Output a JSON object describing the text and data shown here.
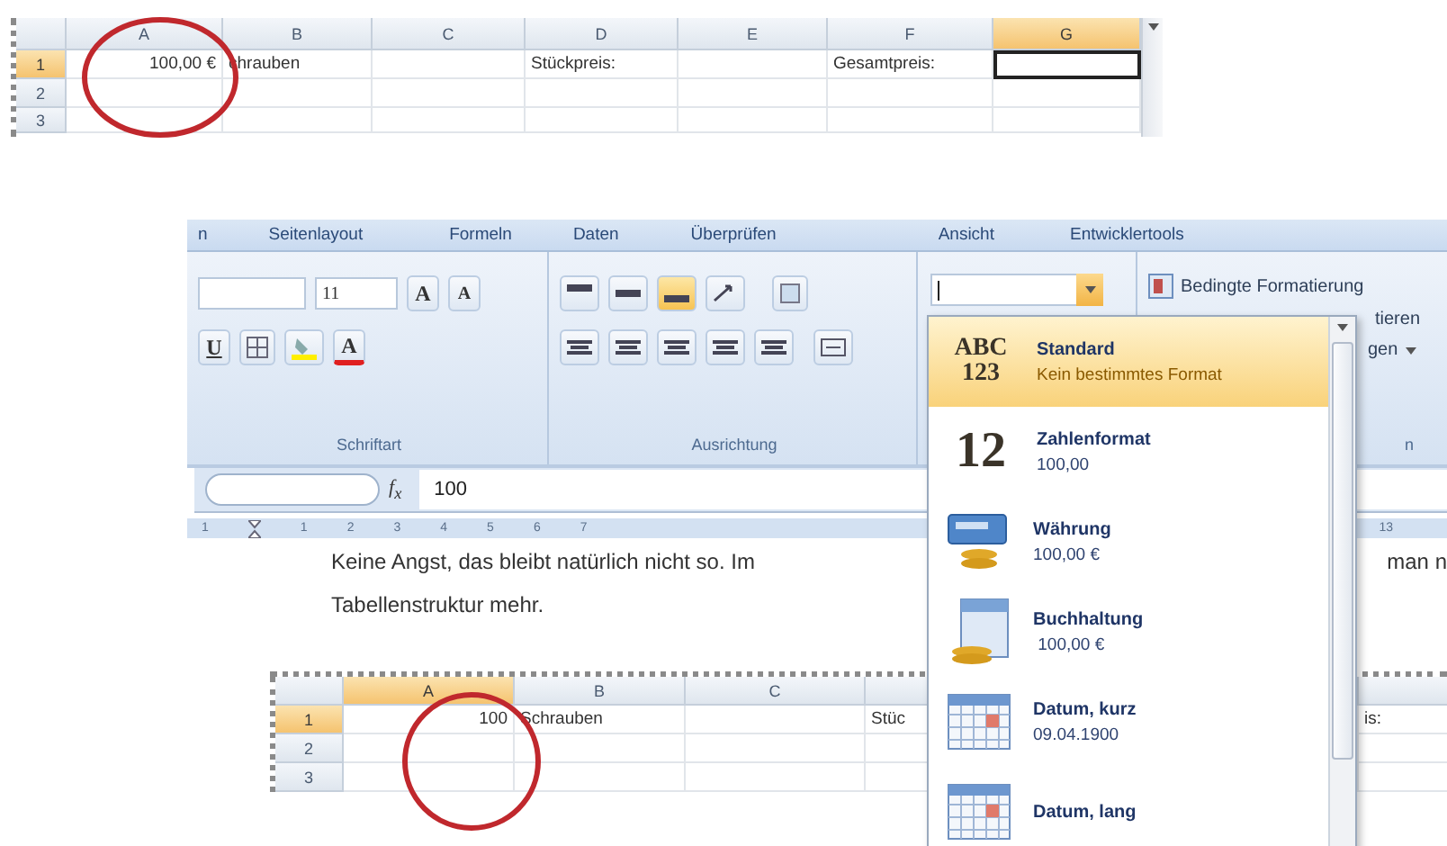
{
  "top_sheet": {
    "columns": [
      {
        "label": "A",
        "selected": false
      },
      {
        "label": "B",
        "selected": false
      },
      {
        "label": "C",
        "selected": false
      },
      {
        "label": "D",
        "selected": false
      },
      {
        "label": "E",
        "selected": false
      },
      {
        "label": "F",
        "selected": false
      },
      {
        "label": "G",
        "selected": true
      }
    ],
    "rows": [
      {
        "number": "1",
        "selected": true,
        "cells": [
          "100,00 €",
          "chrauben",
          "",
          "Stückpreis:",
          "",
          "Gesamtpreis:",
          ""
        ]
      },
      {
        "number": "2",
        "selected": false,
        "cells": [
          "",
          "",
          "",
          "",
          "",
          "",
          ""
        ]
      },
      {
        "number": "3",
        "selected": false,
        "cells": [
          "",
          "",
          "",
          "",
          "",
          "",
          ""
        ]
      }
    ]
  },
  "ribbon": {
    "tabs": [
      "n",
      "Seitenlayout",
      "Formeln",
      "Daten",
      "Überprüfen",
      "Ansicht",
      "Entwicklertools"
    ],
    "font_group": {
      "font_size": "11",
      "grow": "A",
      "shrink": "A",
      "underline": "U",
      "font_color": "A",
      "label": "Schriftart"
    },
    "alignment_group": {
      "vertical_align": [
        {
          "selected": false
        },
        {
          "selected": false
        },
        {
          "selected": true
        }
      ],
      "label": "Ausrichtung"
    },
    "styles_group": {
      "items": [
        "Bedingte Formatierung",
        "tieren",
        "gen"
      ],
      "label": "n"
    }
  },
  "formula_bar": {
    "function_label": "f$_{x}$",
    "value": "100"
  },
  "ruler": {
    "left_labels": [
      "1"
    ],
    "labels": [
      "1",
      "2",
      "3",
      "4",
      "5",
      "6",
      "7"
    ],
    "right_label": "13"
  },
  "body": {
    "lines": [
      {
        "text": "Keine Angst, das bleibt natürlich nicht so. Im",
        "tail": "man n"
      },
      {
        "text": "Tabellenstruktur mehr."
      }
    ]
  },
  "bottom_sheet": {
    "columns": [
      {
        "label": "A",
        "selected": true
      },
      {
        "label": "B",
        "selected": false
      },
      {
        "label": "C",
        "selected": false
      }
    ],
    "rows": [
      {
        "number": "1",
        "selected": true,
        "cells": [
          "100",
          "Schrauben",
          "",
          "Stüc",
          "",
          "is:"
        ]
      },
      {
        "number": "2",
        "selected": false,
        "cells": [
          "",
          "",
          "",
          "",
          "",
          ""
        ]
      },
      {
        "number": "3",
        "selected": false,
        "cells": [
          "",
          "",
          "",
          "",
          "",
          ""
        ]
      }
    ]
  },
  "format_menu": {
    "items": [
      {
        "kind": "text",
        "icon_lines": [
          "ABC",
          "123"
        ],
        "title": "Standard",
        "example": "Kein bestimmtes Format",
        "selected": true
      },
      {
        "kind": "text",
        "icon_lines": [
          "12"
        ],
        "title": "Zahlenformat",
        "example": "100,00",
        "selected": false
      },
      {
        "kind": "currency",
        "title": "Währung",
        "example": "100,00 €",
        "selected": false
      },
      {
        "kind": "accounting",
        "title": "Buchhaltung",
        "example": " 100,00 €",
        "selected": false
      },
      {
        "kind": "calendar",
        "title": "Datum, kurz",
        "example": "09.04.1900",
        "selected": false
      },
      {
        "kind": "calendar",
        "title": "Datum, lang",
        "selected": false
      }
    ]
  }
}
